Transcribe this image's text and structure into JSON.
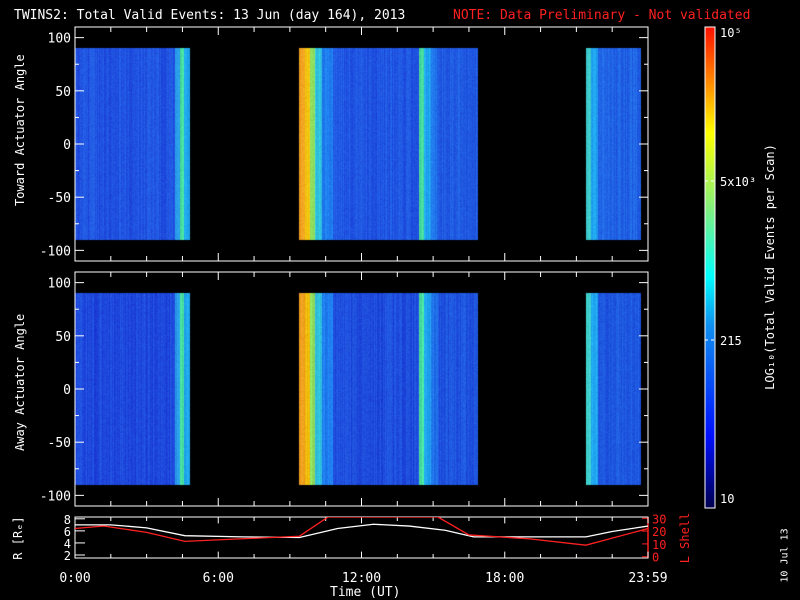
{
  "title": "TWINS2: Total Valid Events: 13 Jun (day 164), 2013",
  "note": "NOTE: Data Preliminary - Not validated",
  "date_stamp": "10 Jul 13",
  "colors": {
    "note": "#ff2020",
    "lshell": "#ff2020",
    "radius": "#ffffff"
  },
  "chart_data": [
    {
      "type": "heatmap",
      "ylabel": "Toward Actuator Angle",
      "ylim": [
        -110,
        110
      ],
      "yticks": [
        "100",
        "50",
        "0",
        "-50",
        "-100"
      ],
      "ytick_values": [
        100,
        50,
        0,
        -50,
        -100
      ],
      "data_range": [
        -90,
        90
      ],
      "xlim_hours": [
        0,
        24
      ],
      "stripes": [
        [
          0,
          4.2,
          "#2052e0"
        ],
        [
          4.2,
          4.4,
          "#2a9ae8"
        ],
        [
          4.4,
          4.55,
          "#48e0a0"
        ],
        [
          4.55,
          4.8,
          "#20a8ee"
        ],
        [
          9.4,
          9.65,
          "#f0a020"
        ],
        [
          9.65,
          9.85,
          "#f2c410"
        ],
        [
          9.85,
          10.05,
          "#90e060"
        ],
        [
          10.05,
          10.35,
          "#30c4e0"
        ],
        [
          10.35,
          10.8,
          "#2080f0"
        ],
        [
          10.8,
          14.4,
          "#2056e2"
        ],
        [
          14.4,
          14.6,
          "#48e0a0"
        ],
        [
          14.6,
          14.9,
          "#20a4f0"
        ],
        [
          14.9,
          15.2,
          "#2072ea"
        ],
        [
          15.2,
          16.9,
          "#205ae2"
        ],
        [
          21.4,
          21.6,
          "#40d4d0"
        ],
        [
          21.6,
          21.9,
          "#20a4f0"
        ],
        [
          21.9,
          23.7,
          "#2062e4"
        ]
      ]
    },
    {
      "type": "heatmap",
      "ylabel": "Away Actuator Angle",
      "ylim": [
        -110,
        110
      ],
      "yticks": [
        "100",
        "50",
        "0",
        "-50",
        "-100"
      ],
      "ytick_values": [
        100,
        50,
        0,
        -50,
        -100
      ],
      "data_range": [
        -90,
        90
      ],
      "xlim_hours": [
        0,
        24
      ],
      "stripes": [
        [
          0,
          4.2,
          "#1e48dc"
        ],
        [
          4.2,
          4.4,
          "#2a9ae8"
        ],
        [
          4.4,
          4.55,
          "#48e0a0"
        ],
        [
          4.55,
          4.8,
          "#20a8ee"
        ],
        [
          9.4,
          9.65,
          "#f0a020"
        ],
        [
          9.65,
          9.85,
          "#f2c410"
        ],
        [
          9.85,
          10.05,
          "#90e060"
        ],
        [
          10.05,
          10.35,
          "#30c4e0"
        ],
        [
          10.35,
          10.8,
          "#2080f0"
        ],
        [
          10.8,
          14.4,
          "#1e4cdc"
        ],
        [
          14.4,
          14.6,
          "#48e0a0"
        ],
        [
          14.6,
          14.9,
          "#20a4f0"
        ],
        [
          14.9,
          15.2,
          "#2072ea"
        ],
        [
          15.2,
          16.9,
          "#1e52de"
        ],
        [
          21.4,
          21.6,
          "#40d4d0"
        ],
        [
          21.6,
          21.9,
          "#20a4f0"
        ],
        [
          21.9,
          23.7,
          "#1e58e0"
        ]
      ]
    },
    {
      "type": "line",
      "xlabel": "Time (UT)",
      "xticks": [
        "0:00",
        "6:00",
        "12:00",
        "18:00",
        "23:59"
      ],
      "xtick_hours": [
        0,
        6,
        12,
        18,
        24
      ],
      "ylabel": "R [Rₑ]",
      "ylim": [
        1.5,
        8.3
      ],
      "yticks": [
        "8",
        "6",
        "4",
        "2"
      ],
      "ytick_values": [
        8,
        6,
        4,
        2
      ],
      "y2label": "L Shell",
      "y2lim": [
        -1,
        31
      ],
      "y2ticks": [
        "30",
        "20",
        "10",
        "0"
      ],
      "y2tick_values": [
        30,
        20,
        10,
        0
      ],
      "series": [
        {
          "name": "R",
          "x": [
            0,
            1.5,
            3,
            4.6,
            7,
            9.4,
            11,
            12.5,
            14,
            15.5,
            16.7,
            19,
            21.4,
            22.5,
            24
          ],
          "y": [
            7.0,
            7.0,
            6.5,
            5.2,
            5.0,
            4.9,
            6.4,
            7.1,
            6.8,
            6.1,
            5.0,
            5.0,
            5.0,
            5.9,
            6.8
          ]
        },
        {
          "name": "L Shell",
          "x": [
            0,
            1.2,
            3,
            4.6,
            7,
            9.4,
            10.6,
            15.2,
            16.5,
            19,
            21.4,
            24
          ],
          "y": [
            22,
            24,
            19,
            12,
            14,
            16,
            31,
            31,
            17,
            14,
            9,
            22
          ]
        }
      ],
      "colorbar": {
        "label": "LOG₁₀(Total Valid Events per Scan)",
        "ticks": [
          "10⁵",
          "5x10³",
          "215",
          "10"
        ]
      }
    }
  ]
}
